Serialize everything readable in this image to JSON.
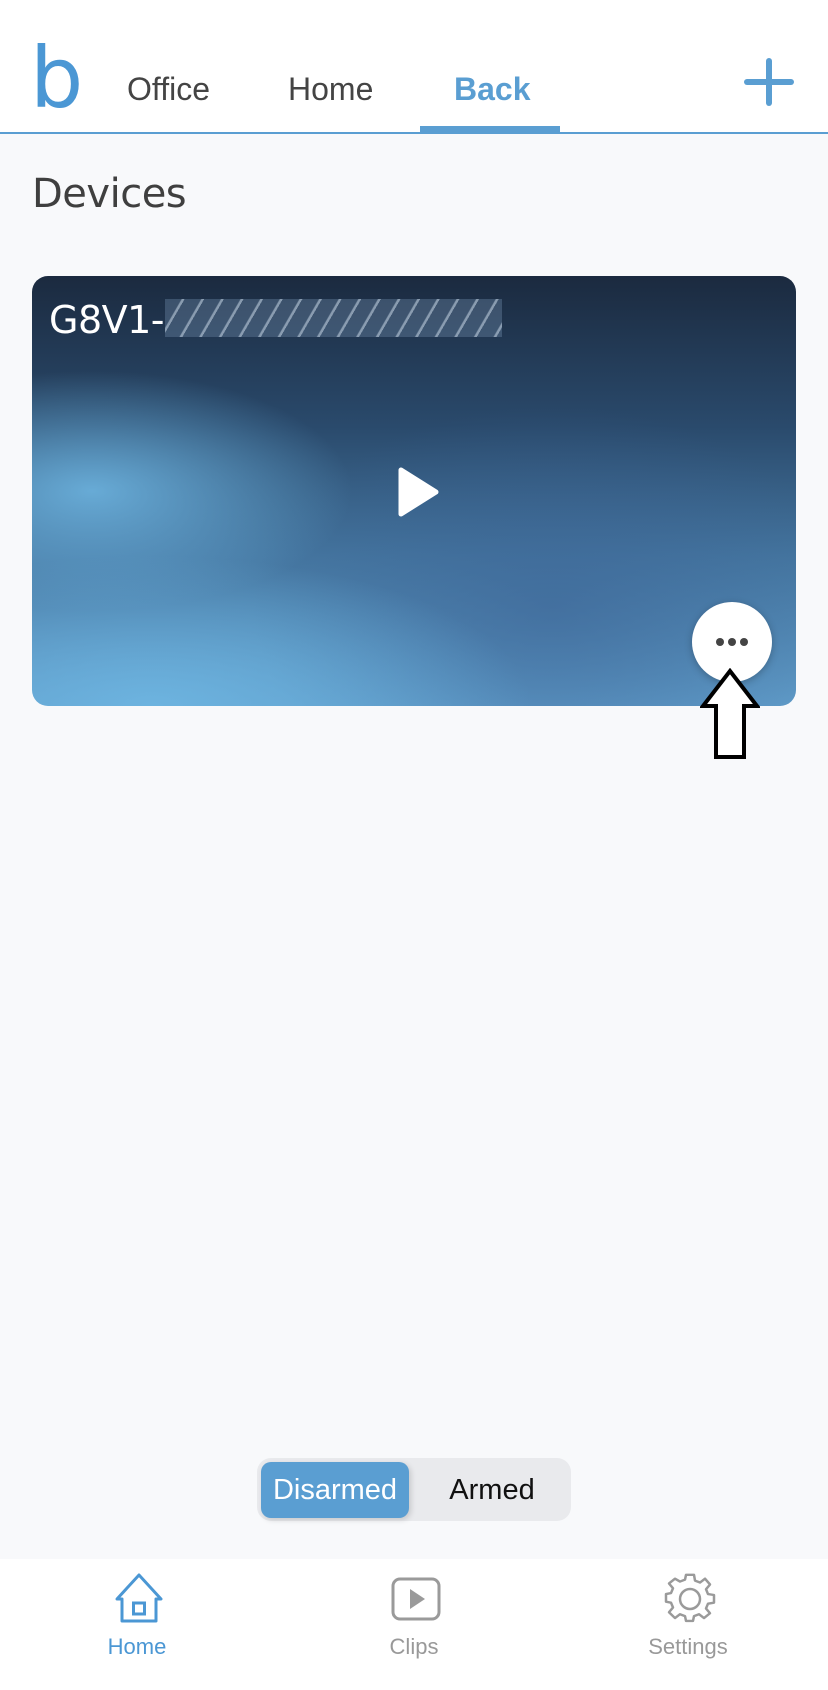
{
  "header": {
    "logo": "b",
    "tabs": [
      {
        "label": "Office",
        "active": false
      },
      {
        "label": "Home",
        "active": false
      },
      {
        "label": "Back",
        "active": true
      }
    ],
    "add_icon": "plus-icon"
  },
  "section": {
    "title": "Devices"
  },
  "device_card": {
    "name_prefix": "G8V1-",
    "name_redacted": true,
    "play_icon": "play-icon",
    "more_icon": "more-horizontal-icon"
  },
  "annotation": {
    "icon": "outline-arrow-up-icon"
  },
  "mode_toggle": {
    "options": [
      "Disarmed",
      "Armed"
    ],
    "selected": "Disarmed"
  },
  "bottom_nav": {
    "items": [
      {
        "label": "Home",
        "icon": "home-icon",
        "active": true
      },
      {
        "label": "Clips",
        "icon": "clips-play-icon",
        "active": false
      },
      {
        "label": "Settings",
        "icon": "gear-icon",
        "active": false
      }
    ]
  },
  "colors": {
    "accent": "#5a9ed2",
    "inactive": "#999999",
    "background": "#f8f9fb"
  }
}
